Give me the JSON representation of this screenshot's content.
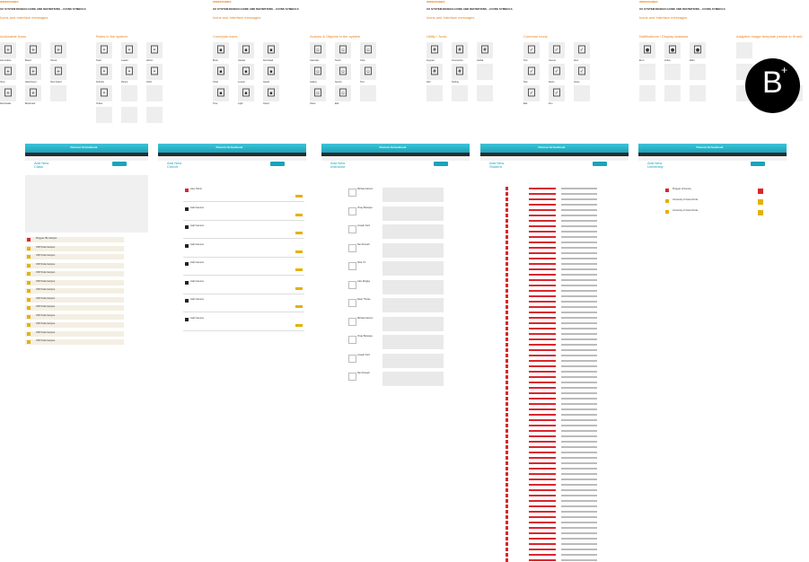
{
  "columns": [
    {
      "title": "WIREFRAMES",
      "subtitle": "UX SYSTEM DESIGN GUIDE AND DEFINITIONS – ICONS SYMBOLS",
      "note": "Icons and Interface messages"
    },
    {
      "title": "WIREFRAMES",
      "subtitle": "UX SYSTEM DESIGN GUIDE AND DEFINITIONS – ICONS SYMBOLS",
      "note": "Icons and Interface messages"
    },
    {
      "title": "WIREFRAMES",
      "subtitle": "UX SYSTEM DESIGN GUIDE AND DEFINITIONS – ICONS SYMBOLS",
      "note": "Icons and Interface messages"
    },
    {
      "title": "WIREFRAMES",
      "subtitle": "UX SYSTEM DESIGN GUIDE AND DEFINITIONS – ICONS SYMBOLS",
      "note": "Icons and Interface messages"
    }
  ],
  "sections": {
    "actionable": "Actionable icons",
    "roles": "Roles in the system",
    "concepts": "Concepts icons",
    "actions": "Actions & Objects in the system",
    "utility": "Utility / Tools",
    "common": "Common icons",
    "notifications": "Notifications / Display statuses",
    "adaptive": "Adaptive image template (resize to fit set)"
  },
  "icon_labels": {
    "actionable": [
      "Add outline",
      "Board",
      "Check",
      "View",
      "Attachment",
      "View board",
      "Downloads",
      "Bookmark"
    ],
    "roles": [
      "Team",
      "Leader",
      "Admin",
      "Schools",
      "Parent",
      "Child",
      "Online"
    ],
    "concepts": [
      "Book",
      "Upload",
      "Download",
      "Chart",
      "Lesson",
      "Award",
      "Time",
      "Light",
      "Cloud"
    ],
    "actions": [
      "Calendar",
      "Touch",
      "Chat",
      "Gallery",
      "Sound",
      "Text",
      "Video",
      "Edit"
    ],
    "utility": [
      "Keypad",
      "Connection",
      "Global",
      "Add",
      "Setting"
    ],
    "common": [
      "Tick",
      "Cancel",
      "Alert",
      "Star",
      "Down",
      "Close",
      "Edit",
      "Pen"
    ],
    "notifications": [
      "Error",
      "Active",
      "Warn"
    ]
  },
  "logo_text": "B",
  "screens": [
    {
      "app": "Pearson Schoolbook",
      "add_title": "Add New",
      "add_sub": "Class"
    },
    {
      "app": "Pearson Schoolbook",
      "add_title": "Add New",
      "add_sub": "Cohort"
    },
    {
      "app": "Pearson Schoolbook",
      "add_title": "Add New",
      "add_sub": "Instructor"
    },
    {
      "app": "Pearson Schoolbook",
      "add_title": "Add New",
      "add_sub": "Student"
    },
    {
      "app": "Pearson Schoolbook",
      "add_title": "Add New",
      "add_sub": "University"
    }
  ],
  "screen1_rows": [
    "Pingyao Hill Campus",
    "VSP Pella Campus",
    "VSP Pella Campus",
    "VSP Pella Campus",
    "VSP Pella Campus",
    "VSP Pella Campus",
    "VSP Pella Campus",
    "VSP Pella Campus",
    "VSP Pella Campus",
    "VSP Pella Campus",
    "VSP Pella Campus",
    "VSP Pella Campus",
    "VSP Pella Campus"
  ],
  "screen2_rows": [
    "Jane Harris",
    "Gabi Ivanova",
    "Gabi Ivanova",
    "Gabi Ivanova",
    "Gabi Ivanova",
    "Gabi Ivanova",
    "Gabi Ivanova",
    "Gabi Ivanova"
  ],
  "screen3_rows": [
    "Michael Aarons",
    "Vinay Banerjee",
    "Joseph Ford",
    "Dan Russell",
    "Nina Yin",
    "Julie Dingley",
    "Dean Thorpe",
    "Michael Aarons",
    "Vinay Banerjee",
    "Joseph Ford",
    "Dan Russell"
  ],
  "screen5_rows": [
    "Pingyao University",
    "University of Grand Forks",
    "University of Grand Forks"
  ]
}
